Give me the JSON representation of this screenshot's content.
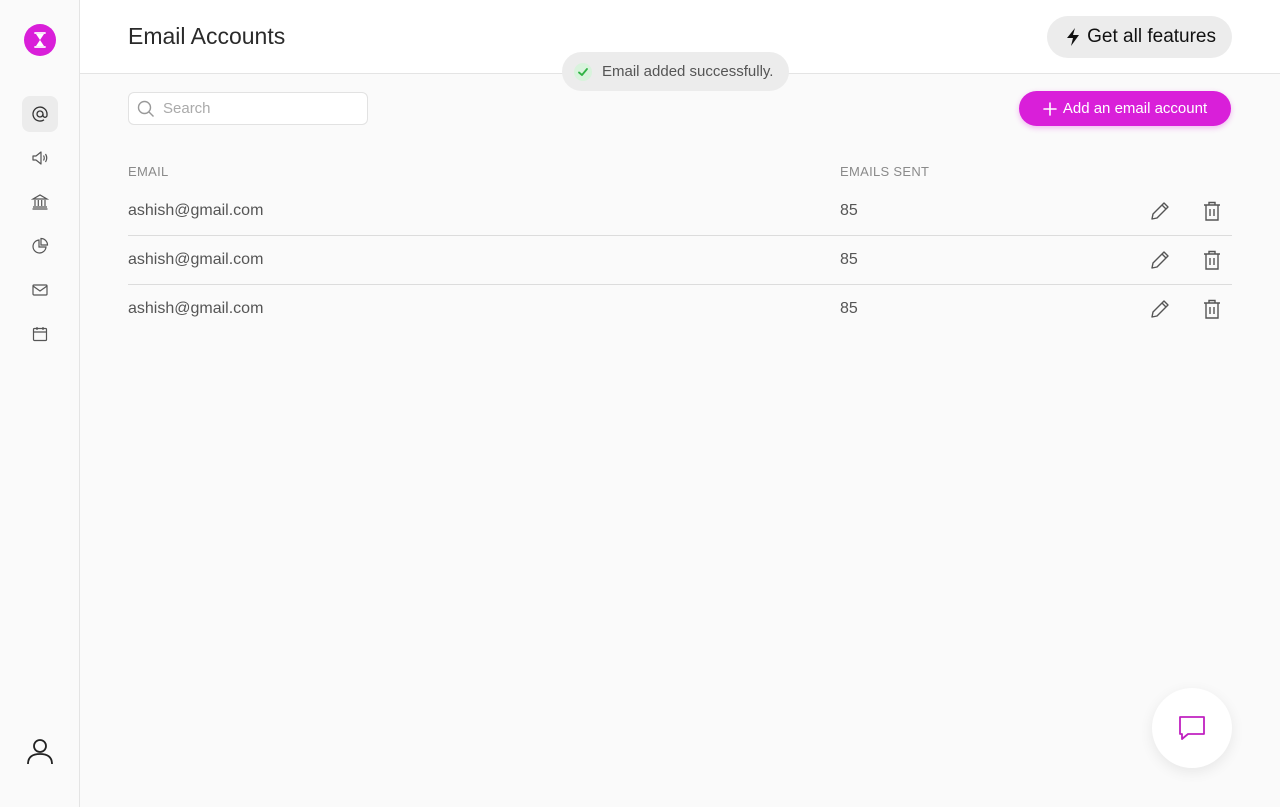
{
  "header": {
    "title": "Email Accounts",
    "features_label": "Get all features"
  },
  "toast": {
    "message": "Email added successfully."
  },
  "search": {
    "placeholder": "Search",
    "value": ""
  },
  "actions": {
    "add_label": "Add an email account"
  },
  "table": {
    "columns": [
      "EMAIL",
      "EMAILS SENT"
    ],
    "rows": [
      {
        "email": "ashish@gmail.com",
        "sent": "85"
      },
      {
        "email": "ashish@gmail.com",
        "sent": "85"
      },
      {
        "email": "ashish@gmail.com",
        "sent": "85"
      }
    ]
  },
  "sidebar": {
    "items": [
      "at-icon",
      "megaphone-icon",
      "bank-icon",
      "pie-chart-icon",
      "mail-icon",
      "calendar-icon"
    ],
    "active": "at-icon"
  },
  "colors": {
    "accent": "#d91fd9",
    "success": "#2fb344"
  }
}
